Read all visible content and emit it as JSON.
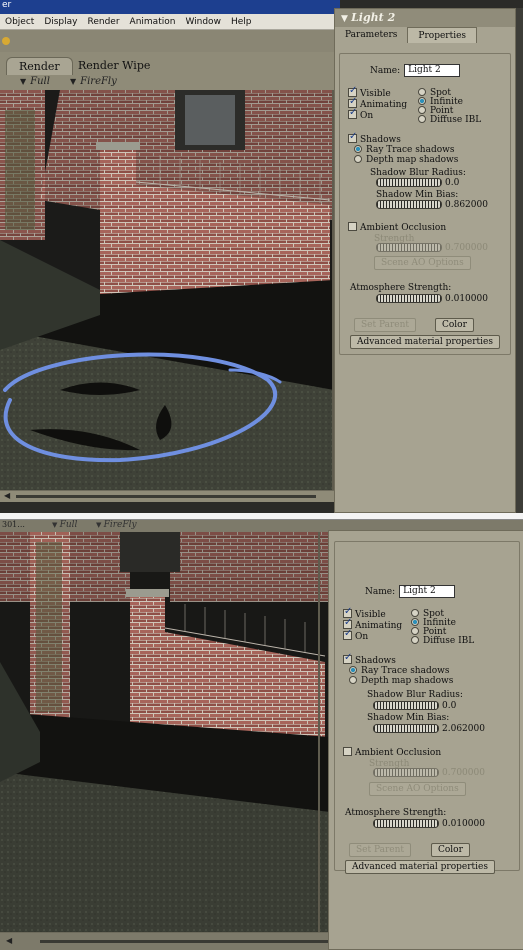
{
  "top": {
    "window_title_fragment": "er",
    "menu": [
      "Object",
      "Display",
      "Render",
      "Animation",
      "Window",
      "Help"
    ],
    "tabs": [
      "Render",
      "Render Wipe"
    ],
    "options": [
      "Full",
      "FireFly"
    ]
  },
  "bottom": {
    "window_title_fragment": "301...",
    "options": [
      "Full",
      "FireFly"
    ]
  },
  "panel": {
    "title": "Light 2",
    "tabs": [
      "Parameters",
      "Properties"
    ],
    "name_label": "Name:",
    "name_value": "Light 2",
    "visible": "Visible",
    "animating": "Animating",
    "on": "On",
    "spot": "Spot",
    "infinite": "Infinite",
    "point": "Point",
    "diffuse_ibl": "Diffuse IBL",
    "shadows": "Shadows",
    "ray_trace": "Ray Trace shadows",
    "depth_map": "Depth map shadows",
    "blur_label": "Shadow Blur Radius:",
    "blur_value": "0.0",
    "bias_label": "Shadow Min Bias:",
    "ambient_occlusion": "Ambient Occlusion",
    "strength": "Strength",
    "strength_value": "0.700000",
    "scene_ao": "Scene AO Options",
    "atmosphere_label": "Atmosphere Strength:",
    "atmosphere_value": "0.010000",
    "set_parent": "Set Parent",
    "color": "Color",
    "advanced": "Advanced material properties"
  },
  "panel1_bias_value": "0.862000",
  "panel2_bias_value": "2.062000",
  "annotation": {
    "color": "#6f8fe0"
  }
}
